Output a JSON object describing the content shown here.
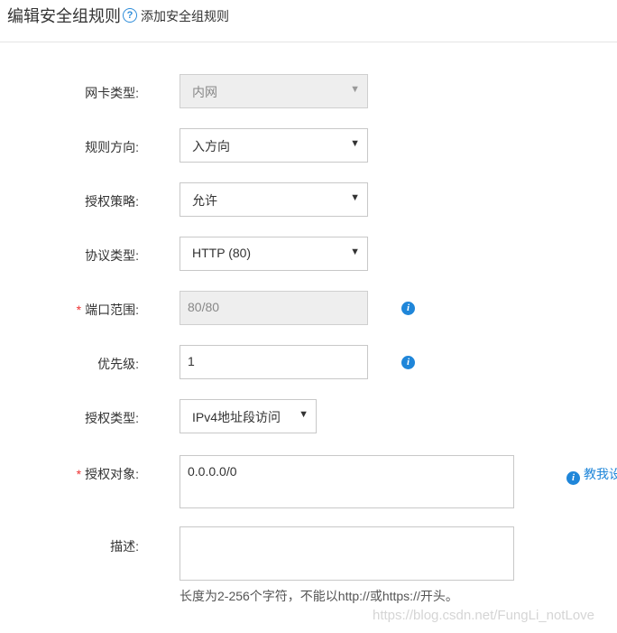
{
  "header": {
    "title": "编辑安全组规则",
    "help_link": "添加安全组规则"
  },
  "form": {
    "nic_type": {
      "label": "网卡类型:",
      "value": "内网",
      "disabled": true
    },
    "direction": {
      "label": "规则方向:",
      "value": "入方向"
    },
    "policy": {
      "label": "授权策略:",
      "value": "允许"
    },
    "protocol": {
      "label": "协议类型:",
      "value": "HTTP (80)"
    },
    "port_range": {
      "label": "端口范围:",
      "value": "80/80",
      "required": true,
      "disabled": true
    },
    "priority": {
      "label": "优先级:",
      "value": "1"
    },
    "auth_type": {
      "label": "授权类型:",
      "value": "IPv4地址段访问"
    },
    "auth_object": {
      "label": "授权对象:",
      "value": "0.0.0.0/0",
      "required": true,
      "link": "教我设置"
    },
    "description": {
      "label": "描述:",
      "value": "",
      "hint": "长度为2-256个字符，不能以http://或https://开头。"
    }
  },
  "icons": {
    "help": "question-circle-icon",
    "info": "info-circle-icon",
    "dropdown": "caret-down-icon"
  },
  "colors": {
    "accent": "#1f86d9",
    "required": "#e33333",
    "border": "#c8c8c8",
    "disabled_bg": "#eeeeee"
  },
  "watermark": "https://blog.csdn.net/FungLi_notLove"
}
